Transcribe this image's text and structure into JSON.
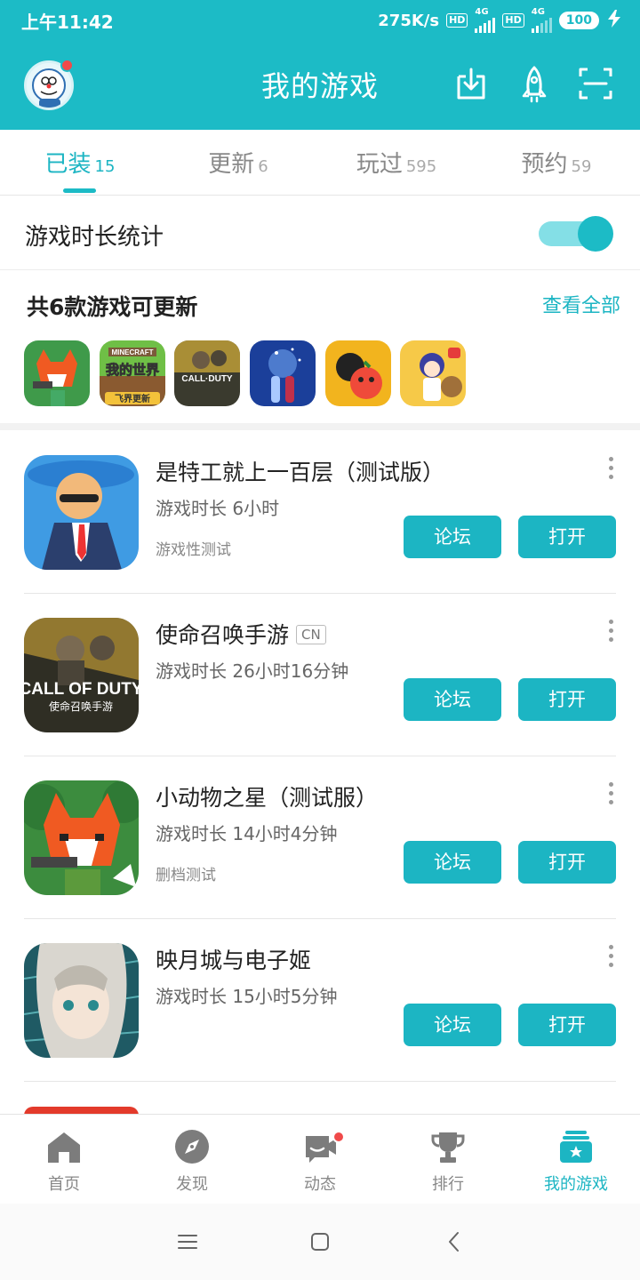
{
  "status_bar": {
    "time": "上午11:42",
    "speed": "275K/s",
    "hd1": "HD",
    "net1": "4G",
    "hd2": "HD",
    "net2": "4G",
    "battery": "100"
  },
  "header": {
    "title": "我的游戏",
    "bg_color": "#1cbbc6",
    "icons": [
      "download-icon",
      "rocket-icon",
      "scan-icon"
    ]
  },
  "tabs": [
    {
      "label": "已装",
      "count": "15",
      "active": true
    },
    {
      "label": "更新",
      "count": "6",
      "active": false
    },
    {
      "label": "玩过",
      "count": "595",
      "active": false
    },
    {
      "label": "预约",
      "count": "59",
      "active": false
    }
  ],
  "playtime_toggle": {
    "label": "游戏时长统计",
    "enabled": true
  },
  "updates": {
    "title": "共6款游戏可更新",
    "view_all": "查看全部",
    "mini_icon_texts": {
      "minecraft_top": "MINECRAFT",
      "minecraft_name": "我的世界",
      "minecraft_badge": "飞界更新",
      "cod": "CALL·DUTY"
    }
  },
  "games": [
    {
      "name": "是特工就上一百层（测试版）",
      "tag": "",
      "playtime": "游戏时长 6小时",
      "note": "游戏性测试",
      "forum": "论坛",
      "open": "打开"
    },
    {
      "name": "使命召唤手游",
      "tag": "CN",
      "playtime": "游戏时长 26小时16分钟",
      "note": "",
      "forum": "论坛",
      "open": "打开",
      "icon_text": "CALL OF DUTY",
      "icon_subtext": "使命召唤手游"
    },
    {
      "name": "小动物之星（测试服）",
      "tag": "",
      "playtime": "游戏时长 14小时4分钟",
      "note": "删档测试",
      "forum": "论坛",
      "open": "打开"
    },
    {
      "name": "映月城与电子姬",
      "tag": "",
      "playtime": "游戏时长 15小时5分钟",
      "note": "",
      "forum": "论坛",
      "open": "打开"
    }
  ],
  "bottom_nav": [
    {
      "label": "首页",
      "icon": "home-icon",
      "active": false
    },
    {
      "label": "发现",
      "icon": "compass-icon",
      "active": false
    },
    {
      "label": "动态",
      "icon": "chat-icon",
      "active": false,
      "badge": true
    },
    {
      "label": "排行",
      "icon": "trophy-icon",
      "active": false
    },
    {
      "label": "我的游戏",
      "icon": "my-games-icon",
      "active": true
    }
  ],
  "accent_color": "#1cb5c3"
}
